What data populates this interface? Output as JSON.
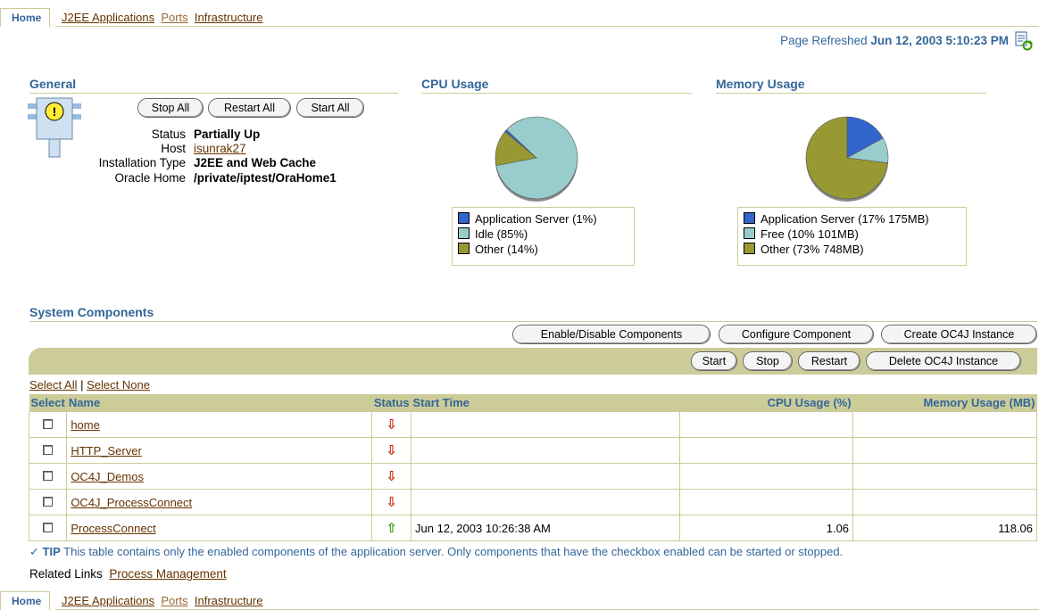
{
  "tabs": {
    "home": "Home",
    "j2ee": "J2EE Applications",
    "ports": "Ports",
    "infrastructure": "Infrastructure"
  },
  "refresh": {
    "label": "Page Refreshed",
    "time": "Jun 12, 2003 5:10:23 PM"
  },
  "general": {
    "title": "General",
    "buttons": {
      "stop_all": "Stop All",
      "restart_all": "Restart All",
      "start_all": "Start All"
    },
    "status_label": "Status",
    "status_value": "Partially Up",
    "host_label": "Host",
    "host_value": "isunrak27",
    "install_label": "Installation Type",
    "install_value": "J2EE and Web Cache",
    "oracle_label": "Oracle Home",
    "oracle_value": "/private/iptest/OraHome1"
  },
  "cpu": {
    "title": "CPU Usage",
    "legend": [
      "Application Server (1%)",
      "Idle (85%)",
      "Other (14%)"
    ]
  },
  "memory": {
    "title": "Memory Usage",
    "legend": [
      "Application Server (17% 175MB)",
      "Free (10% 101MB)",
      "Other (73% 748MB)"
    ]
  },
  "colors": {
    "app_server": "#3366cc",
    "idle": "#99cccc",
    "other": "#999933",
    "header_bg": "#cccc99",
    "header_text": "#336699",
    "link": "#663300"
  },
  "chart_data": [
    {
      "type": "pie",
      "title": "CPU Usage",
      "categories": [
        "Application Server",
        "Idle",
        "Other"
      ],
      "values": [
        1,
        85,
        14
      ]
    },
    {
      "type": "pie",
      "title": "Memory Usage",
      "categories": [
        "Application Server",
        "Free",
        "Other"
      ],
      "values": [
        17,
        10,
        73
      ]
    }
  ],
  "components": {
    "title": "System Components",
    "buttons": {
      "enable_disable": "Enable/Disable Components",
      "configure": "Configure Component",
      "create_oc4j": "Create OC4J Instance",
      "start": "Start",
      "stop": "Stop",
      "restart": "Restart",
      "delete_oc4j": "Delete OC4J Instance"
    },
    "select_all": "Select All",
    "separator": "|",
    "select_none": "Select None",
    "columns": {
      "select": "Select",
      "name": "Name",
      "status": "Status",
      "start_time": "Start Time",
      "cpu": "CPU Usage (%)",
      "memory": "Memory Usage (MB)"
    },
    "rows": [
      {
        "name": "home",
        "status": "down",
        "start_time": "",
        "cpu": "",
        "memory": ""
      },
      {
        "name": "HTTP_Server",
        "status": "down",
        "start_time": "",
        "cpu": "",
        "memory": ""
      },
      {
        "name": "OC4J_Demos",
        "status": "down",
        "start_time": "",
        "cpu": "",
        "memory": ""
      },
      {
        "name": "OC4J_ProcessConnect",
        "status": "down",
        "start_time": "",
        "cpu": "",
        "memory": ""
      },
      {
        "name": "ProcessConnect",
        "status": "up",
        "start_time": "Jun 12, 2003 10:26:38 AM",
        "cpu": "1.06",
        "memory": "118.06"
      }
    ]
  },
  "tip": {
    "label": "TIP",
    "text": "This table contains only the enabled components of the application server. Only components that have the checkbox enabled can be started or stopped."
  },
  "related": {
    "label": "Related Links",
    "link": "Process Management"
  }
}
